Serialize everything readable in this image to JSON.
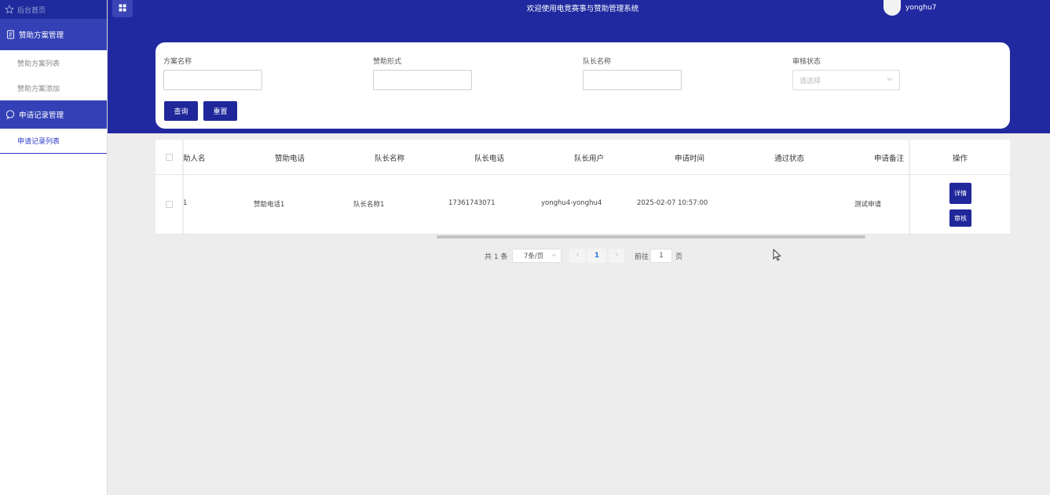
{
  "sidebar": {
    "home": "后台首页",
    "groups": [
      {
        "label": "赞助方案管理",
        "items": [
          "赞助方案列表",
          "赞助方案添加"
        ]
      },
      {
        "label": "申请记录管理",
        "items": [
          "申请记录列表"
        ]
      }
    ]
  },
  "header": {
    "title": "欢迎使用电竞赛事与赞助管理系统",
    "username": "yonghu7"
  },
  "search": {
    "fields": [
      "方案名称",
      "赞助形式",
      "队长名称",
      "审核状态"
    ],
    "status_placeholder": "请选择",
    "query_button": "查询",
    "reset_button": "重置"
  },
  "table": {
    "columns": [
      "助人名",
      "赞助电话",
      "队长名称",
      "队长电话",
      "队长用户",
      "申请时间",
      "通过状态",
      "申请备注",
      "操作"
    ],
    "rows": [
      {
        "name": "1",
        "phone": "赞助电话1",
        "captain_name": "队长名称1",
        "captain_phone": "17361743071",
        "captain_user": "yonghu4-yonghu4",
        "apply_time": "2025-02-07 10:57:00",
        "status": "",
        "remark": "测试申请",
        "detail_button": "详情",
        "review_button": "审核"
      }
    ]
  },
  "pagination": {
    "total": "共 1 条",
    "page_size": "7条/页",
    "current_page": "1",
    "goto_label": "前往",
    "goto_value": "1",
    "page_suffix": "页"
  }
}
